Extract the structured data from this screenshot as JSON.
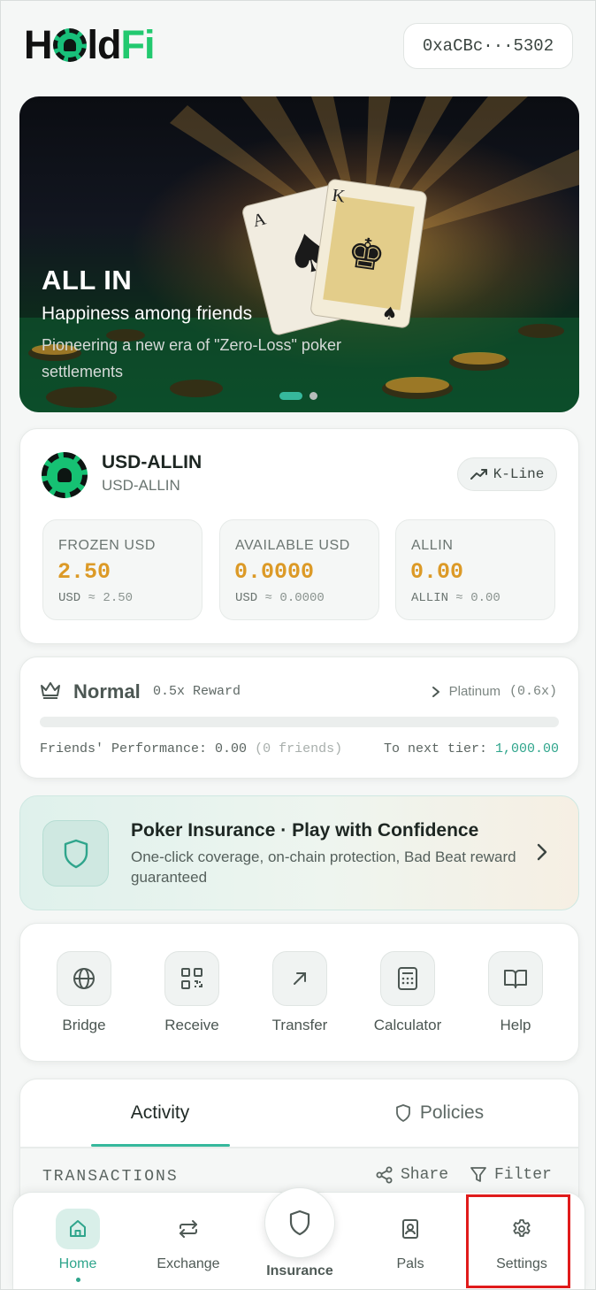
{
  "header": {
    "logo": {
      "part1": "H",
      "part2": "ld",
      "part3": "Fi"
    },
    "wallet_address": "0xaCBc···5302"
  },
  "banner": {
    "title": "ALL IN",
    "subtitle": "Happiness among friends",
    "description": "Pioneering a new era of \"Zero-Loss\" poker settlements",
    "slide_count": 2,
    "active_slide": 1
  },
  "token": {
    "name": "USD-ALLIN",
    "symbol": "USD-ALLIN",
    "kline_label": "K-Line",
    "stats": [
      {
        "label": "FROZEN USD",
        "value": "2.50",
        "foot_unit": "USD",
        "foot_approx": "≈ 2.50"
      },
      {
        "label": "AVAILABLE USD",
        "value": "0.0000",
        "foot_unit": "USD",
        "foot_approx": "≈ 0.0000"
      },
      {
        "label": "ALLIN",
        "value": "0.00",
        "foot_unit": "ALLIN",
        "foot_approx": "≈ 0.00"
      }
    ]
  },
  "tier": {
    "name": "Normal",
    "reward": "0.5x Reward",
    "next_tier_name": "Platinum",
    "next_tier_multiplier": "(0.6x)",
    "progress": 0,
    "friends_perf_label": "Friends' Performance:",
    "friends_perf_value": "0.00",
    "friends_count": "(0 friends)",
    "to_next_label": "To next tier:",
    "to_next_value": "1,000.00"
  },
  "promo": {
    "title": "Poker Insurance · Play with Confidence",
    "description": "One-click coverage, on-chain protection, Bad Beat reward guaranteed"
  },
  "actions": [
    {
      "label": "Bridge",
      "icon": "globe-icon"
    },
    {
      "label": "Receive",
      "icon": "qr-code-icon"
    },
    {
      "label": "Transfer",
      "icon": "arrow-up-right-icon"
    },
    {
      "label": "Calculator",
      "icon": "calculator-icon"
    },
    {
      "label": "Help",
      "icon": "book-icon"
    }
  ],
  "tabs": {
    "activity": "Activity",
    "policies": "Policies",
    "active": "activity"
  },
  "transactions": {
    "title": "TRANSACTIONS",
    "share_label": "Share",
    "filter_label": "Filter"
  },
  "bottom_nav": {
    "items": [
      {
        "label": "Home",
        "icon": "home-icon",
        "active": true
      },
      {
        "label": "Exchange",
        "icon": "exchange-icon"
      },
      {
        "label": "Insurance",
        "icon": "shield-icon"
      },
      {
        "label": "Pals",
        "icon": "contact-card-icon"
      },
      {
        "label": "Settings",
        "icon": "gear-icon"
      }
    ]
  },
  "colors": {
    "accent": "#36b89c",
    "value_gold": "#dc9a27",
    "brand_green": "#22c96f",
    "highlight": "#e01b1b"
  }
}
